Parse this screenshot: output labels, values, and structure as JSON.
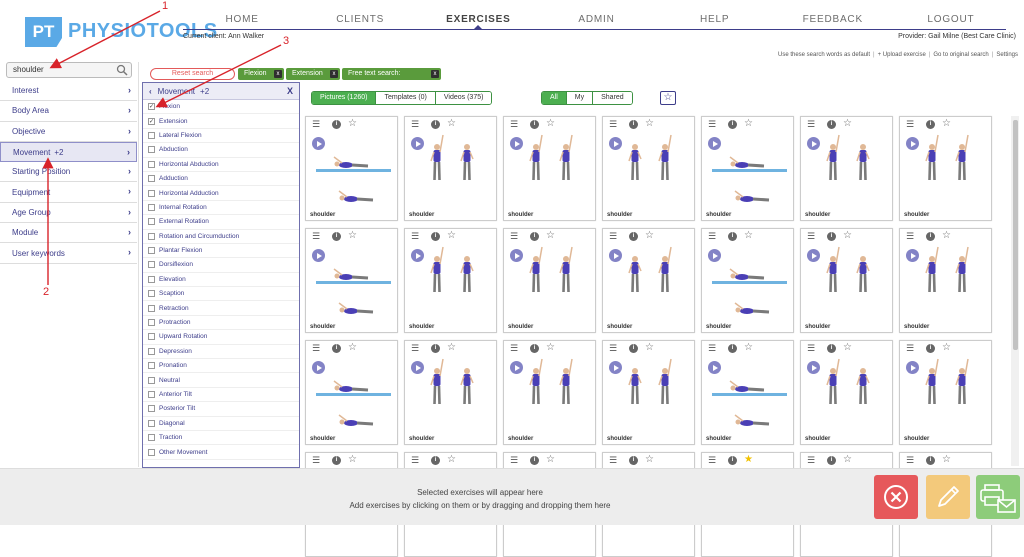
{
  "header": {
    "logo_mark": "PT",
    "logo_text": "PHYSIOTOOLS",
    "nav": [
      "HOME",
      "CLIENTS",
      "EXERCISES",
      "ADMIN",
      "HELP",
      "FEEDBACK",
      "LOGOUT"
    ],
    "active_nav": "EXERCISES",
    "current_client": "Current client: Ann Walker",
    "provider": "Provider: Gail Milne (Best Care Clinic)",
    "tools": [
      "Use these search words as default",
      "+ Upload exercise",
      "Go to original search",
      "Settings"
    ]
  },
  "search": {
    "value": "shoulder"
  },
  "sidebar": {
    "items": [
      {
        "label": "Interest",
        "badge": ""
      },
      {
        "label": "Body Area",
        "badge": ""
      },
      {
        "label": "Objective",
        "badge": ""
      },
      {
        "label": "Movement",
        "badge": "+2"
      },
      {
        "label": "Starting Position",
        "badge": ""
      },
      {
        "label": "Equipment",
        "badge": ""
      },
      {
        "label": "Age Group",
        "badge": ""
      },
      {
        "label": "Module",
        "badge": ""
      },
      {
        "label": "User keywords",
        "badge": ""
      }
    ]
  },
  "movement_panel": {
    "title": "Movement",
    "badge": "+2",
    "close": "X",
    "options": [
      {
        "label": "Flexion",
        "checked": true
      },
      {
        "label": "Extension",
        "checked": true
      },
      {
        "label": "Lateral Flexion",
        "checked": false
      },
      {
        "label": "Abduction",
        "checked": false
      },
      {
        "label": "Horizontal Abduction",
        "checked": false
      },
      {
        "label": "Adduction",
        "checked": false
      },
      {
        "label": "Horizontal Adduction",
        "checked": false
      },
      {
        "label": "Internal Rotation",
        "checked": false
      },
      {
        "label": "External Rotation",
        "checked": false
      },
      {
        "label": "Rotation and Circumduction",
        "checked": false
      },
      {
        "label": "Plantar Flexion",
        "checked": false
      },
      {
        "label": "Dorsiflexion",
        "checked": false
      },
      {
        "label": "Elevation",
        "checked": false
      },
      {
        "label": "Scaption",
        "checked": false
      },
      {
        "label": "Retraction",
        "checked": false
      },
      {
        "label": "Protraction",
        "checked": false
      },
      {
        "label": "Upward Rotation",
        "checked": false
      },
      {
        "label": "Depression",
        "checked": false
      },
      {
        "label": "Pronation",
        "checked": false
      },
      {
        "label": "Neutral",
        "checked": false
      },
      {
        "label": "Anterior Tilt",
        "checked": false
      },
      {
        "label": "Posterior Tilt",
        "checked": false
      },
      {
        "label": "Diagonal",
        "checked": false
      },
      {
        "label": "Traction",
        "checked": false
      },
      {
        "label": "Other Movement",
        "checked": false
      }
    ]
  },
  "filters_bar": {
    "reset_label": "Reset search",
    "chips": [
      "Flexion",
      "Extension",
      "Free text search: shoulder"
    ],
    "chip_close": "x"
  },
  "tabs": {
    "media": [
      "Pictures (1260)",
      "Templates (0)",
      "Videos (375)"
    ],
    "media_active": 0,
    "owner": [
      "All",
      "My",
      "Shared"
    ],
    "owner_active": 0,
    "favorites_icon": "☆"
  },
  "grid": {
    "cards": [
      {
        "tag": "shoulder",
        "fav": false
      },
      {
        "tag": "shoulder",
        "fav": false
      },
      {
        "tag": "shoulder",
        "fav": false
      },
      {
        "tag": "shoulder",
        "fav": false
      },
      {
        "tag": "shoulder",
        "fav": false
      },
      {
        "tag": "shoulder",
        "fav": false
      },
      {
        "tag": "shoulder",
        "fav": false
      },
      {
        "tag": "shoulder",
        "fav": false
      },
      {
        "tag": "shoulder",
        "fav": false
      },
      {
        "tag": "shoulder",
        "fav": false
      },
      {
        "tag": "shoulder",
        "fav": false
      },
      {
        "tag": "shoulder",
        "fav": false
      },
      {
        "tag": "shoulder",
        "fav": false
      },
      {
        "tag": "shoulder",
        "fav": false
      },
      {
        "tag": "shoulder",
        "fav": false
      },
      {
        "tag": "shoulder",
        "fav": false
      },
      {
        "tag": "shoulder",
        "fav": false
      },
      {
        "tag": "shoulder",
        "fav": false
      },
      {
        "tag": "shoulder",
        "fav": false
      },
      {
        "tag": "shoulder",
        "fav": false
      },
      {
        "tag": "shoulder",
        "fav": false
      },
      {
        "tag": "",
        "fav": false
      },
      {
        "tag": "",
        "fav": false
      },
      {
        "tag": "",
        "fav": false
      },
      {
        "tag": "",
        "fav": false
      },
      {
        "tag": "",
        "fav": true
      },
      {
        "tag": "",
        "fav": false
      },
      {
        "tag": "",
        "fav": false
      }
    ],
    "icons": {
      "menu": "☰",
      "info": "i",
      "star": "☆",
      "star_fav": "★"
    }
  },
  "bottom": {
    "msg1": "Selected exercises will appear here",
    "msg2": "Add exercises by clicking on them or by dragging and dropping them here"
  },
  "annotations": [
    "1",
    "2",
    "3"
  ],
  "colors": {
    "brand": "#5aa9e6",
    "nav_accent": "#3d3d8a",
    "chip_green": "#5a9b3c",
    "tab_green": "#4caf50",
    "reset_red": "#e35a5a",
    "annotation_red": "#d8232a"
  }
}
